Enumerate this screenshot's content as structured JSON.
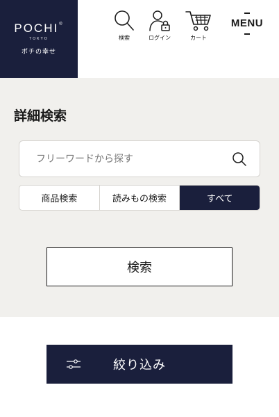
{
  "header": {
    "logo": {
      "wordmark": "POCHI",
      "registered_mark": "®",
      "city": "TOKYO",
      "tagline": "ポチの幸せ"
    },
    "nav": [
      {
        "icon": "search-icon",
        "label": "検索"
      },
      {
        "icon": "user-lock-icon",
        "label": "ログイン"
      },
      {
        "icon": "cart-icon",
        "label": "カート"
      }
    ],
    "menu_label": "MENU"
  },
  "search_panel": {
    "title": "詳細検索",
    "input": {
      "placeholder": "フリーワードから探す",
      "value": ""
    },
    "tabs": [
      {
        "label": "商品検索",
        "active": false
      },
      {
        "label": "読みもの検索",
        "active": false
      },
      {
        "label": "すべて",
        "active": true
      }
    ],
    "submit_label": "検索"
  },
  "filter": {
    "label": "絞り込み",
    "icon": "sliders-icon"
  },
  "colors": {
    "navy": "#1a1f3c",
    "panel_bg": "#f1f0ed",
    "border": "#d5d3cf"
  }
}
